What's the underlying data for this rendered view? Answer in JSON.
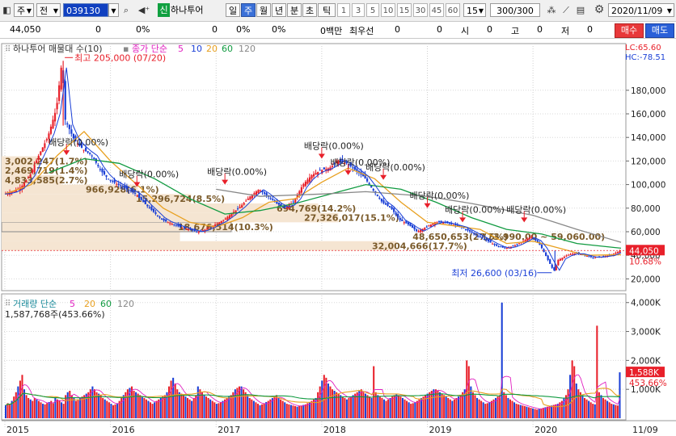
{
  "toolbar": {
    "kind": "주",
    "market": "전",
    "code": "039130",
    "badge": "신",
    "stock_name": "하나투어",
    "periods": [
      "일",
      "주",
      "월",
      "년",
      "분",
      "초",
      "틱"
    ],
    "active_period": "주",
    "intervals": [
      "1",
      "3",
      "5",
      "10",
      "15",
      "30",
      "45",
      "60"
    ],
    "interval_value": "15",
    "count": "300/300",
    "date": "2020/11/09"
  },
  "infobar": {
    "price": "44,050",
    "v1": "0",
    "v2": "0%",
    "v3": "0",
    "v4": "0%",
    "v5": "0%",
    "v6": "0백만",
    "lbl_best": "최우선",
    "v7": "0",
    "v8": "0",
    "lbl_open": "시",
    "v9": "0",
    "lbl_high": "고",
    "v10": "0",
    "lbl_low": "저",
    "v11": "0",
    "buy_label": "매수",
    "sell_label": "매도"
  },
  "colors": {
    "up": "#e8202a",
    "down": "#1a3fd6",
    "ma5": "#e020c0",
    "ma10": "#1a3fd6",
    "ma20": "#e8a020",
    "ma60": "#109a40",
    "ma120": "#888888",
    "band": "#f5e5d2",
    "label_brown": "#7a5a2a"
  },
  "chart_data": [
    {
      "type": "candlestick",
      "title": "하나투어 매물대 수(10)",
      "legend": {
        "prefix": "종가 단순",
        "periods": [
          "5",
          "10",
          "20",
          "60",
          "120"
        ]
      },
      "corner": {
        "lc": "LC:65.60",
        "hc": "HC:-78.51"
      },
      "yticks": [
        "180,000",
        "160,000",
        "140,000",
        "120,000",
        "100,000",
        "80,000",
        "60,000",
        "40,000",
        "20,000"
      ],
      "ytick_values": [
        180000,
        160000,
        140000,
        120000,
        100000,
        80000,
        60000,
        40000,
        20000
      ],
      "ylim": [
        10000,
        210000
      ],
      "xticks": [
        "2015",
        "2016",
        "2017",
        "2018",
        "2019",
        "2020"
      ],
      "xlabel_right": "11/09",
      "current_price_label": "44,050",
      "current_pct_label": "10.68%",
      "x_start": "2015-01",
      "x_end": "2020-11",
      "price_path": [
        [
          "2015-01",
          92000
        ],
        [
          "2015-02",
          94000
        ],
        [
          "2015-03",
          98000
        ],
        [
          "2015-04",
          108000
        ],
        [
          "2015-05",
          125000
        ],
        [
          "2015-06",
          140000
        ],
        [
          "2015-07",
          165000
        ],
        [
          "2015-07-20",
          205000
        ],
        [
          "2015-08",
          155000
        ],
        [
          "2015-09",
          138000
        ],
        [
          "2015-10",
          130000
        ],
        [
          "2015-11",
          125000
        ],
        [
          "2015-12",
          112000
        ],
        [
          "2016-01",
          104000
        ],
        [
          "2016-02",
          100000
        ],
        [
          "2016-03",
          96000
        ],
        [
          "2016-04",
          92000
        ],
        [
          "2016-05",
          84000
        ],
        [
          "2016-06",
          77000
        ],
        [
          "2016-07",
          70000
        ],
        [
          "2016-08",
          67000
        ],
        [
          "2016-09",
          64000
        ],
        [
          "2016-10",
          62000
        ],
        [
          "2016-11",
          60000
        ],
        [
          "2016-12",
          62000
        ],
        [
          "2017-01",
          66000
        ],
        [
          "2017-02",
          70000
        ],
        [
          "2017-03",
          76000
        ],
        [
          "2017-04",
          82000
        ],
        [
          "2017-05",
          90000
        ],
        [
          "2017-06",
          96000
        ],
        [
          "2017-07",
          90000
        ],
        [
          "2017-08",
          84000
        ],
        [
          "2017-09",
          80000
        ],
        [
          "2017-10",
          86000
        ],
        [
          "2017-11",
          100000
        ],
        [
          "2017-12",
          108000
        ],
        [
          "2018-01",
          112000
        ],
        [
          "2018-02",
          114000
        ],
        [
          "2018-03",
          120000
        ],
        [
          "2018-04",
          118000
        ],
        [
          "2018-05",
          112000
        ],
        [
          "2018-06",
          106000
        ],
        [
          "2018-07",
          95000
        ],
        [
          "2018-08",
          85000
        ],
        [
          "2018-09",
          80000
        ],
        [
          "2018-10",
          70000
        ],
        [
          "2018-11",
          66000
        ],
        [
          "2018-12",
          60000
        ],
        [
          "2019-01",
          64000
        ],
        [
          "2019-02",
          68000
        ],
        [
          "2019-03",
          68000
        ],
        [
          "2019-04",
          66000
        ],
        [
          "2019-05",
          64000
        ],
        [
          "2019-06",
          60000
        ],
        [
          "2019-07",
          56000
        ],
        [
          "2019-08",
          52000
        ],
        [
          "2019-09",
          48000
        ],
        [
          "2019-10",
          46000
        ],
        [
          "2019-11",
          48000
        ],
        [
          "2019-12",
          52000
        ],
        [
          "2020-01",
          56000
        ],
        [
          "2020-02",
          48000
        ],
        [
          "2020-03-16",
          26600
        ],
        [
          "2020-04",
          36000
        ],
        [
          "2020-05",
          40000
        ],
        [
          "2020-06",
          42000
        ],
        [
          "2020-07",
          40000
        ],
        [
          "2020-08",
          38000
        ],
        [
          "2020-09",
          39000
        ],
        [
          "2020-10",
          40000
        ],
        [
          "2020-11",
          44050
        ]
      ],
      "moving_averages": {
        "ma20": [
          [
            "2015-01",
            92000
          ],
          [
            "2015-04",
            100000
          ],
          [
            "2015-07",
            125000
          ],
          [
            "2015-10",
            145000
          ],
          [
            "2016-01",
            120000
          ],
          [
            "2016-04",
            100000
          ],
          [
            "2016-07",
            80000
          ],
          [
            "2016-10",
            68000
          ],
          [
            "2017-01",
            64000
          ],
          [
            "2017-04",
            72000
          ],
          [
            "2017-07",
            85000
          ],
          [
            "2017-10",
            88000
          ],
          [
            "2018-01",
            102000
          ],
          [
            "2018-04",
            114000
          ],
          [
            "2018-07",
            105000
          ],
          [
            "2018-10",
            85000
          ],
          [
            "2019-01",
            68000
          ],
          [
            "2019-04",
            65000
          ],
          [
            "2019-07",
            62000
          ],
          [
            "2019-10",
            50000
          ],
          [
            "2020-01",
            52000
          ],
          [
            "2020-04",
            46000
          ],
          [
            "2020-07",
            40000
          ],
          [
            "2020-11",
            40500
          ]
        ],
        "ma60": [
          [
            "2015-06",
            110000
          ],
          [
            "2015-10",
            122000
          ],
          [
            "2016-02",
            118000
          ],
          [
            "2016-06",
            105000
          ],
          [
            "2016-10",
            88000
          ],
          [
            "2017-02",
            75000
          ],
          [
            "2017-06",
            78000
          ],
          [
            "2017-10",
            84000
          ],
          [
            "2018-02",
            92000
          ],
          [
            "2018-06",
            100000
          ],
          [
            "2018-10",
            96000
          ],
          [
            "2019-02",
            85000
          ],
          [
            "2019-06",
            72000
          ],
          [
            "2019-10",
            62000
          ],
          [
            "2020-02",
            58000
          ],
          [
            "2020-06",
            50000
          ],
          [
            "2020-11",
            46000
          ]
        ],
        "ma120": [
          [
            "2017-01",
            96000
          ],
          [
            "2017-06",
            90000
          ],
          [
            "2018-01",
            92000
          ],
          [
            "2018-06",
            94000
          ],
          [
            "2019-01",
            90000
          ],
          [
            "2019-06",
            84000
          ],
          [
            "2020-01",
            74000
          ],
          [
            "2020-06",
            62000
          ],
          [
            "2020-11",
            51000
          ]
        ]
      },
      "volume_profile": [
        {
          "price_low": 44000,
          "price_high": 52000,
          "label": "32,004,666(17.7%)"
        },
        {
          "price_low": 52000,
          "price_high": 60000,
          "label": ""
        },
        {
          "price_low": 60000,
          "price_high": 68000,
          "label": "18,676,514(10.3%)"
        },
        {
          "price_low": 68000,
          "price_high": 76000,
          "label": "27,326,017(15.1%)"
        },
        {
          "price_low": 76000,
          "price_high": 84000,
          "label": "694,769(14.2%)"
        },
        {
          "price_low": 84000,
          "price_high": 92000,
          "label": "15,296,724(8.5%)"
        },
        {
          "price_low": 92000,
          "price_high": 100000,
          "label": "966,928(6.1%)"
        },
        {
          "price_low": 100000,
          "price_high": 108000,
          "label": "4,833,585(2.7%)"
        },
        {
          "price_low": 108000,
          "price_high": 116000,
          "label": "2,469,719(1.4%)"
        },
        {
          "price_low": 116000,
          "price_high": 124000,
          "label": "3,002,247(1.7%)"
        }
      ],
      "extra_labels": [
        {
          "date": "2019-03",
          "price": 56000,
          "text": "48,650,653(27.5%)"
        },
        {
          "date": "2019-11",
          "price": 56000,
          "text": "(73,990.00 ~ 59,060.00)"
        }
      ],
      "dividend_marks": [
        {
          "date": "2015-08",
          "price": 125000,
          "text": "배당락(0.00%)"
        },
        {
          "date": "2016-04",
          "price": 98000,
          "text": "배당락(0.00%)"
        },
        {
          "date": "2017-02",
          "price": 100000,
          "text": "배당락(0.00%)"
        },
        {
          "date": "2018-01",
          "price": 122000,
          "text": "배당락(0.00%)"
        },
        {
          "date": "2018-04",
          "price": 108000,
          "text": "배당락(0.00%)"
        },
        {
          "date": "2018-08",
          "price": 104000,
          "text": "배당락(0.00%)"
        },
        {
          "date": "2019-01",
          "price": 80000,
          "text": "배당락(0.00%)"
        },
        {
          "date": "2019-05",
          "price": 68000,
          "text": "배당락(0.00%)"
        },
        {
          "date": "2019-12",
          "price": 68000,
          "text": "배당락(0.00%)"
        }
      ],
      "annotations": {
        "high": {
          "date": "2015-07-20",
          "price": 205000,
          "text": "최고 205,000 (07/20)"
        },
        "low": {
          "date": "2020-03-16",
          "price": 26600,
          "text": "최저 26,600 (03/16)"
        }
      }
    },
    {
      "type": "bar",
      "title": "거래량 단순",
      "legend_periods": [
        "5",
        "20",
        "60",
        "120"
      ],
      "value_label": "1,587,768주(453.66%)",
      "yticks": [
        "4,000K",
        "3,000K",
        "2,000K",
        "1,000K"
      ],
      "ytick_values": [
        4000,
        3000,
        2000,
        1000
      ],
      "ylim": [
        0,
        4300
      ],
      "current_label": "1,588K",
      "current_pct_label": "453.66%",
      "volume_k": [
        450,
        520,
        480,
        600,
        750,
        900,
        1100,
        1300,
        1500,
        1000,
        800,
        700,
        650,
        600,
        700,
        650,
        600,
        550,
        500,
        480,
        520,
        560,
        600,
        520,
        700,
        650,
        600,
        550,
        500,
        800,
        900,
        950,
        800,
        700,
        600,
        650,
        700,
        750,
        800,
        850,
        900,
        1000,
        1100,
        1000,
        900,
        850,
        800,
        700,
        650,
        600,
        550,
        500,
        450,
        480,
        520,
        600,
        700,
        800,
        900,
        1000,
        1050,
        1100,
        950,
        900,
        850,
        800,
        750,
        700,
        650,
        600,
        550,
        500,
        550,
        600,
        650,
        700,
        750,
        800,
        900,
        1100,
        1300,
        1400,
        1200,
        1000,
        900,
        850,
        800,
        750,
        700,
        650,
        600,
        700,
        800,
        1100,
        1000,
        900,
        800,
        750,
        700,
        650,
        600,
        550,
        500,
        520,
        560,
        600,
        650,
        700,
        750,
        800,
        900,
        1000,
        1050,
        1100,
        1100,
        1000,
        900,
        800,
        700,
        650,
        600,
        550,
        500,
        450,
        480,
        520,
        560,
        600,
        650,
        700,
        750,
        800,
        700,
        650,
        600,
        550,
        500,
        480,
        460,
        440,
        420,
        400,
        420,
        440,
        460,
        480,
        520,
        560,
        600,
        650,
        700,
        900,
        1100,
        1300,
        1500,
        1400,
        1200,
        1100,
        1000,
        950,
        900,
        850,
        800,
        750,
        700,
        650,
        700,
        750,
        800,
        850,
        900,
        950,
        1000,
        900,
        850,
        800,
        750,
        700,
        1800,
        900,
        800,
        750,
        700,
        650,
        600,
        650,
        700,
        750,
        800,
        850,
        800,
        750,
        700,
        650,
        600,
        550,
        500,
        520,
        560,
        600,
        650,
        700,
        750,
        800,
        850,
        900,
        950,
        1000,
        1000,
        950,
        900,
        850,
        800,
        750,
        700,
        650,
        600,
        650,
        700,
        750,
        800,
        900,
        1000,
        2000,
        1800,
        1100,
        900,
        800,
        700,
        650,
        600,
        550,
        500,
        520,
        560,
        600,
        650,
        700,
        750,
        800,
        4000,
        900,
        800,
        700,
        650,
        600,
        550,
        500,
        480,
        460,
        440,
        420,
        400,
        380,
        360,
        340,
        320,
        300,
        320,
        340,
        360,
        380,
        400,
        420,
        440,
        460,
        480,
        500,
        550,
        600,
        700,
        800,
        1000,
        1500,
        2000,
        1800,
        1200,
        1000,
        900,
        800,
        700,
        650,
        600,
        550,
        500,
        480,
        3200,
        900,
        800,
        700,
        650,
        600,
        550,
        500,
        480,
        460,
        440,
        1588
      ]
    }
  ]
}
